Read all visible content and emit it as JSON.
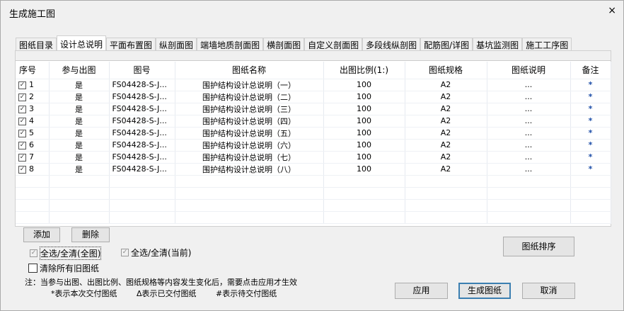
{
  "window": {
    "title": "生成施工图",
    "close": "×"
  },
  "tabs": [
    "图纸目录",
    "设计总说明",
    "平面布置图",
    "纵剖面图",
    "端墙地质剖面图",
    "横剖面图",
    "自定义剖面图",
    "多段线纵剖图",
    "配筋图/详图",
    "基坑监测图",
    "施工工序图"
  ],
  "active_tab": 1,
  "table": {
    "headers": [
      "序号",
      "参与出图",
      "图号",
      "图纸名称",
      "出图比例(1:)",
      "图纸规格",
      "图纸说明",
      "备注"
    ],
    "rows": [
      {
        "checked": true,
        "no": "1",
        "join": "是",
        "code": "FS04428-S-J...",
        "name": "围护结构设计总说明（一）",
        "scale": "100",
        "size": "A2",
        "desc": "...",
        "note": "*"
      },
      {
        "checked": true,
        "no": "2",
        "join": "是",
        "code": "FS04428-S-J...",
        "name": "围护结构设计总说明（二）",
        "scale": "100",
        "size": "A2",
        "desc": "...",
        "note": "*"
      },
      {
        "checked": true,
        "no": "3",
        "join": "是",
        "code": "FS04428-S-J...",
        "name": "围护结构设计总说明（三）",
        "scale": "100",
        "size": "A2",
        "desc": "...",
        "note": "*"
      },
      {
        "checked": true,
        "no": "4",
        "join": "是",
        "code": "FS04428-S-J...",
        "name": "围护结构设计总说明（四）",
        "scale": "100",
        "size": "A2",
        "desc": "...",
        "note": "*"
      },
      {
        "checked": true,
        "no": "5",
        "join": "是",
        "code": "FS04428-S-J...",
        "name": "围护结构设计总说明（五）",
        "scale": "100",
        "size": "A2",
        "desc": "...",
        "note": "*"
      },
      {
        "checked": true,
        "no": "6",
        "join": "是",
        "code": "FS04428-S-J...",
        "name": "围护结构设计总说明（六）",
        "scale": "100",
        "size": "A2",
        "desc": "...",
        "note": "*"
      },
      {
        "checked": true,
        "no": "7",
        "join": "是",
        "code": "FS04428-S-J...",
        "name": "围护结构设计总说明（七）",
        "scale": "100",
        "size": "A2",
        "desc": "...",
        "note": "*"
      },
      {
        "checked": true,
        "no": "8",
        "join": "是",
        "code": "FS04428-S-J...",
        "name": "围护结构设计总说明（八）",
        "scale": "100",
        "size": "A2",
        "desc": "...",
        "note": "*"
      }
    ]
  },
  "buttons": {
    "add": "添加",
    "delete": "删除",
    "sort": "图纸排序",
    "apply": "应用",
    "generate": "生成图纸",
    "cancel": "取消"
  },
  "checks": {
    "all_global": "全选/全清(全图)",
    "all_current": "全选/全清(当前)",
    "clear_old": "清除所有旧图纸"
  },
  "notes": {
    "line1": "注：当参与出图、出图比例、图纸规格等内容发生变化后，需要点击应用才生效",
    "legend1": "*表示本次交付图纸",
    "legend2": "Δ表示已交付图纸",
    "legend3": "#表示待交付图纸"
  }
}
